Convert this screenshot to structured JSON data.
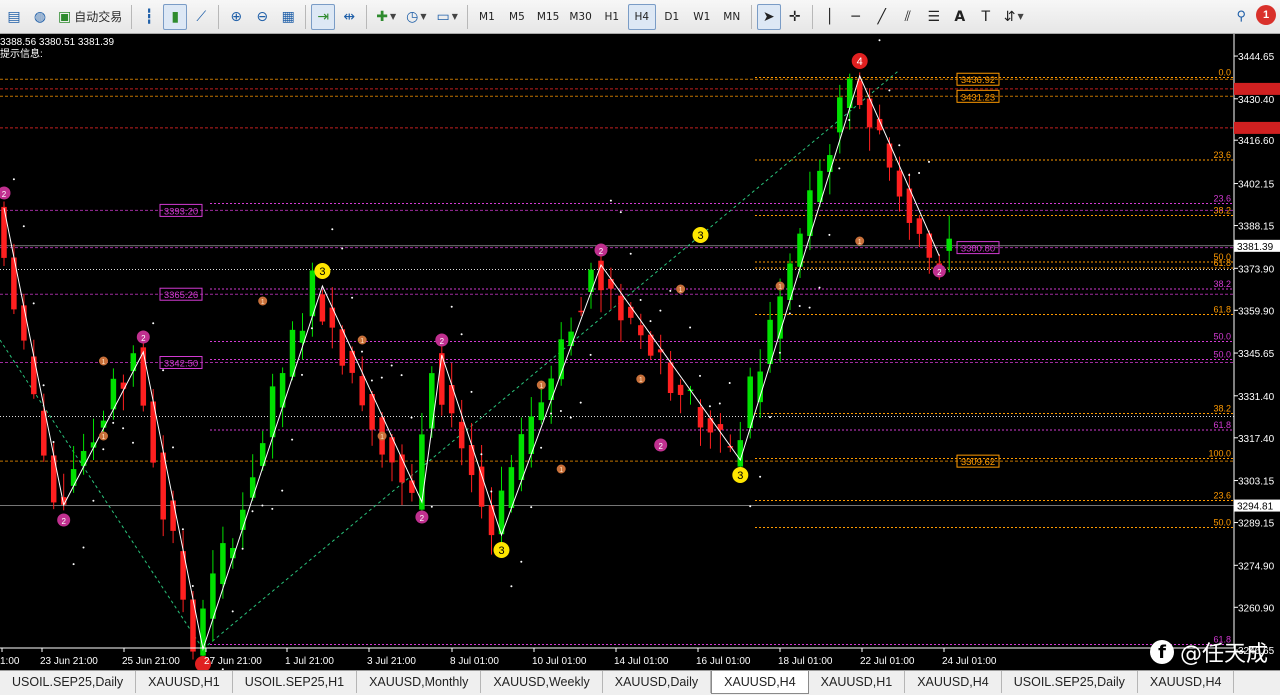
{
  "toolbar": {
    "auto_trade_label": "自动交易",
    "timeframes": [
      "M1",
      "M5",
      "M15",
      "M30",
      "H1",
      "H4",
      "D1",
      "W1",
      "MN"
    ],
    "active_timeframe": "H4",
    "notification_count": "1"
  },
  "info": {
    "ohlc": "3388.56 3380.51 3381.39",
    "hint_label": "提示信息:"
  },
  "colors": {
    "bull": "#00e000",
    "bear": "#ff2020",
    "zigzag": "#ffffff",
    "fib_magenta": "#d23ad2",
    "fib_orange": "#ff9a00",
    "axis_text": "#ffffff"
  },
  "chart_data": {
    "type": "candlestick",
    "symbol": "XAUUSD",
    "timeframe": "H4",
    "ylim": [
      3240,
      3452
    ],
    "price_axis_labels": [
      "3444.65",
      "3430.40",
      "3416.60",
      "3402.15",
      "3388.15",
      "3373.90",
      "3359.90",
      "3345.65",
      "3331.40",
      "3317.40",
      "3303.15",
      "3289.15",
      "3274.90",
      "3260.90",
      "3246.65"
    ],
    "current_price": "3381.39",
    "marked_price": "3294.81",
    "time_labels": [
      "1:00",
      "23 Jun 21:00",
      "25 Jun 21:00",
      "27 Jun 21:00",
      "1 Jul 21:00",
      "3 Jul 21:00",
      "8 Jul 01:00",
      "10 Jul 01:00",
      "14 Jul 01:00",
      "16 Jul 01:00",
      "18 Jul 01:00",
      "22 Jul 01:00",
      "24 Jul 01:00"
    ],
    "price_boxes": [
      {
        "label": "3436.92",
        "value": 3436.92,
        "color": "#ff9a00"
      },
      {
        "label": "3431.23",
        "value": 3431.23,
        "color": "#ff9a00"
      },
      {
        "label": "3393.20",
        "value": 3393.2,
        "color": "#d23ad2"
      },
      {
        "label": "3380.80",
        "value": 3380.8,
        "color": "#d23ad2"
      },
      {
        "label": "3365.26",
        "value": 3365.26,
        "color": "#d23ad2"
      },
      {
        "label": "3342.50",
        "value": 3342.5,
        "color": "#d23ad2"
      },
      {
        "label": "3309.62",
        "value": 3309.62,
        "color": "#ff9a00"
      }
    ],
    "fib_labels": [
      {
        "label": "0.0",
        "value": 3437.5,
        "color": "#ff9a00"
      },
      {
        "label": "23.6",
        "value": 3410.0,
        "color": "#ff9a00"
      },
      {
        "label": "23.6",
        "value": 3395.5,
        "color": "#d23ad2"
      },
      {
        "label": "38.2",
        "value": 3391.5,
        "color": "#ff9a00"
      },
      {
        "label": "50.0",
        "value": 3376.0,
        "color": "#ff9a00"
      },
      {
        "label": "61.8",
        "value": 3374.0,
        "color": "#ff9a00"
      },
      {
        "label": "38.2",
        "value": 3367.0,
        "color": "#d23ad2"
      },
      {
        "label": "61.8",
        "value": 3358.5,
        "color": "#ff9a00"
      },
      {
        "label": "50.0",
        "value": 3349.5,
        "color": "#d23ad2"
      },
      {
        "label": "50.0",
        "value": 3343.5,
        "color": "#d23ad2"
      },
      {
        "label": "38.2",
        "value": 3325.5,
        "color": "#ff9a00"
      },
      {
        "label": "61.8",
        "value": 3320.0,
        "color": "#d23ad2"
      },
      {
        "label": "100.0",
        "value": 3310.5,
        "color": "#ff9a00"
      },
      {
        "label": "23.6",
        "value": 3296.5,
        "color": "#ff9a00"
      },
      {
        "label": "50.0",
        "value": 3287.5,
        "color": "#ff9a00"
      },
      {
        "label": "61.8",
        "value": 3248.5,
        "color": "#d23ad2"
      }
    ],
    "zigzag": [
      [
        0,
        3394
      ],
      [
        3,
        3295
      ],
      [
        7,
        3346
      ],
      [
        10,
        3247
      ],
      [
        16,
        3368
      ],
      [
        21,
        3296
      ],
      [
        22,
        3345
      ],
      [
        25,
        3285
      ],
      [
        30,
        3375
      ],
      [
        37,
        3310
      ],
      [
        43,
        3438
      ],
      [
        47,
        3378
      ]
    ],
    "wave_labels": [
      {
        "i": 0,
        "price": 3394,
        "text": "2",
        "kind": "magenta",
        "pos": "above"
      },
      {
        "i": 3,
        "price": 3295,
        "text": "2",
        "kind": "magenta",
        "pos": "below"
      },
      {
        "i": 7,
        "price": 3346,
        "text": "2",
        "kind": "magenta",
        "pos": "above"
      },
      {
        "i": 10,
        "price": 3247,
        "text": "",
        "kind": "red",
        "pos": "below"
      },
      {
        "i": 16,
        "price": 3368,
        "text": "3",
        "kind": "yellow",
        "pos": "above"
      },
      {
        "i": 21,
        "price": 3296,
        "text": "2",
        "kind": "magenta",
        "pos": "below"
      },
      {
        "i": 22,
        "price": 3345,
        "text": "2",
        "kind": "magenta",
        "pos": "above"
      },
      {
        "i": 25,
        "price": 3285,
        "text": "3",
        "kind": "yellow",
        "pos": "below"
      },
      {
        "i": 30,
        "price": 3375,
        "text": "2",
        "kind": "magenta",
        "pos": "above"
      },
      {
        "i": 33,
        "price": 3320,
        "text": "2",
        "kind": "magenta",
        "pos": "below"
      },
      {
        "i": 35,
        "price": 3380,
        "text": "3",
        "kind": "yellow",
        "pos": "above"
      },
      {
        "i": 37,
        "price": 3310,
        "text": "3",
        "kind": "yellow",
        "pos": "below"
      },
      {
        "i": 43,
        "price": 3438,
        "text": "4",
        "kind": "red",
        "pos": "above"
      },
      {
        "i": 47,
        "price": 3378,
        "text": "2",
        "kind": "magenta",
        "pos": "below"
      }
    ]
  },
  "tabs": [
    "USOIL.SEP25,Daily",
    "XAUUSD,H1",
    "USOIL.SEP25,H1",
    "XAUUSD,Monthly",
    "XAUUSD,Weekly",
    "XAUUSD,Daily",
    "XAUUSD,H4",
    "XAUUSD,H1",
    "XAUUSD,H4",
    "USOIL.SEP25,Daily",
    "XAUUSD,H4"
  ],
  "active_tab": 6,
  "watermark": "@任天成"
}
